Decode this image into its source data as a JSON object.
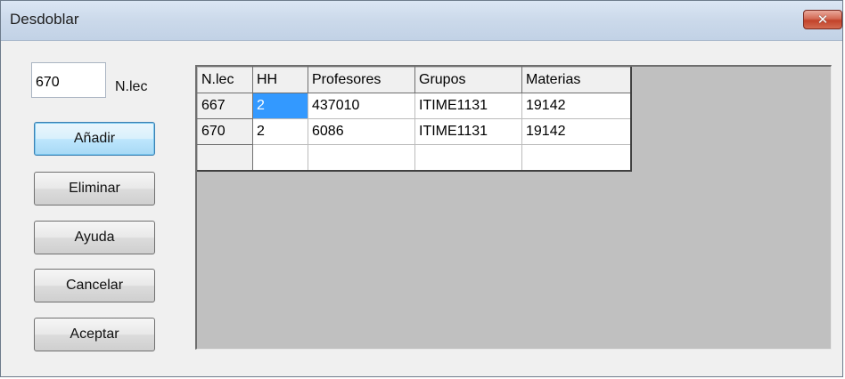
{
  "window": {
    "title": "Desdoblar",
    "close_icon": "close-x-icon"
  },
  "form": {
    "nlec_value": "670",
    "nlec_label": "N.lec"
  },
  "buttons": {
    "add": "Añadir",
    "delete": "Eliminar",
    "help": "Ayuda",
    "cancel": "Cancelar",
    "accept": "Aceptar"
  },
  "grid": {
    "columns": [
      "N.lec",
      "HH",
      "Profesores",
      "Grupos",
      "Materias"
    ],
    "rows": [
      {
        "nlec": "667",
        "hh": "2",
        "profesores": "437010",
        "grupos": "ITIME1131",
        "materias": "19142"
      },
      {
        "nlec": "670",
        "hh": "2",
        "profesores": "6086",
        "grupos": "ITIME1131",
        "materias": "19142"
      },
      {
        "nlec": "",
        "hh": "",
        "profesores": "",
        "grupos": "",
        "materias": ""
      }
    ]
  },
  "colors": {
    "selection": "#3399ff",
    "panel_bg": "#c0c0c0",
    "dialog_bg": "#f0f0f0"
  }
}
